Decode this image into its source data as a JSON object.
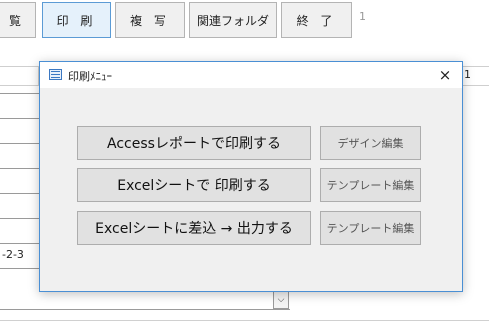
{
  "toolbar": {
    "partial_label": "覧",
    "buttons": [
      {
        "label": "印 刷"
      },
      {
        "label": "複 写"
      },
      {
        "label": "関連フォルダ"
      },
      {
        "label": "終 了"
      }
    ],
    "page_number": "1"
  },
  "background": {
    "text_right": "1",
    "text_left": "-2-3"
  },
  "dialog": {
    "title": "印刷ﾒﾆｭｰ",
    "close_label": "×",
    "actions": [
      {
        "label": "Accessレポートで印刷する",
        "edit_label": "デザイン編集"
      },
      {
        "label": "Excelシートで 印刷する",
        "edit_label": "テンプレート編集"
      },
      {
        "label": "Excelシートに差込 → 出力する",
        "edit_label": "テンプレート編集"
      }
    ]
  },
  "icons": {
    "app": "form-window-icon",
    "close": "close-icon",
    "combo": "chevron-down-icon"
  },
  "colors": {
    "active_button_border": "#5b9bd5",
    "dialog_border": "#4a8fd4",
    "button_face": "#e1e1e1"
  }
}
